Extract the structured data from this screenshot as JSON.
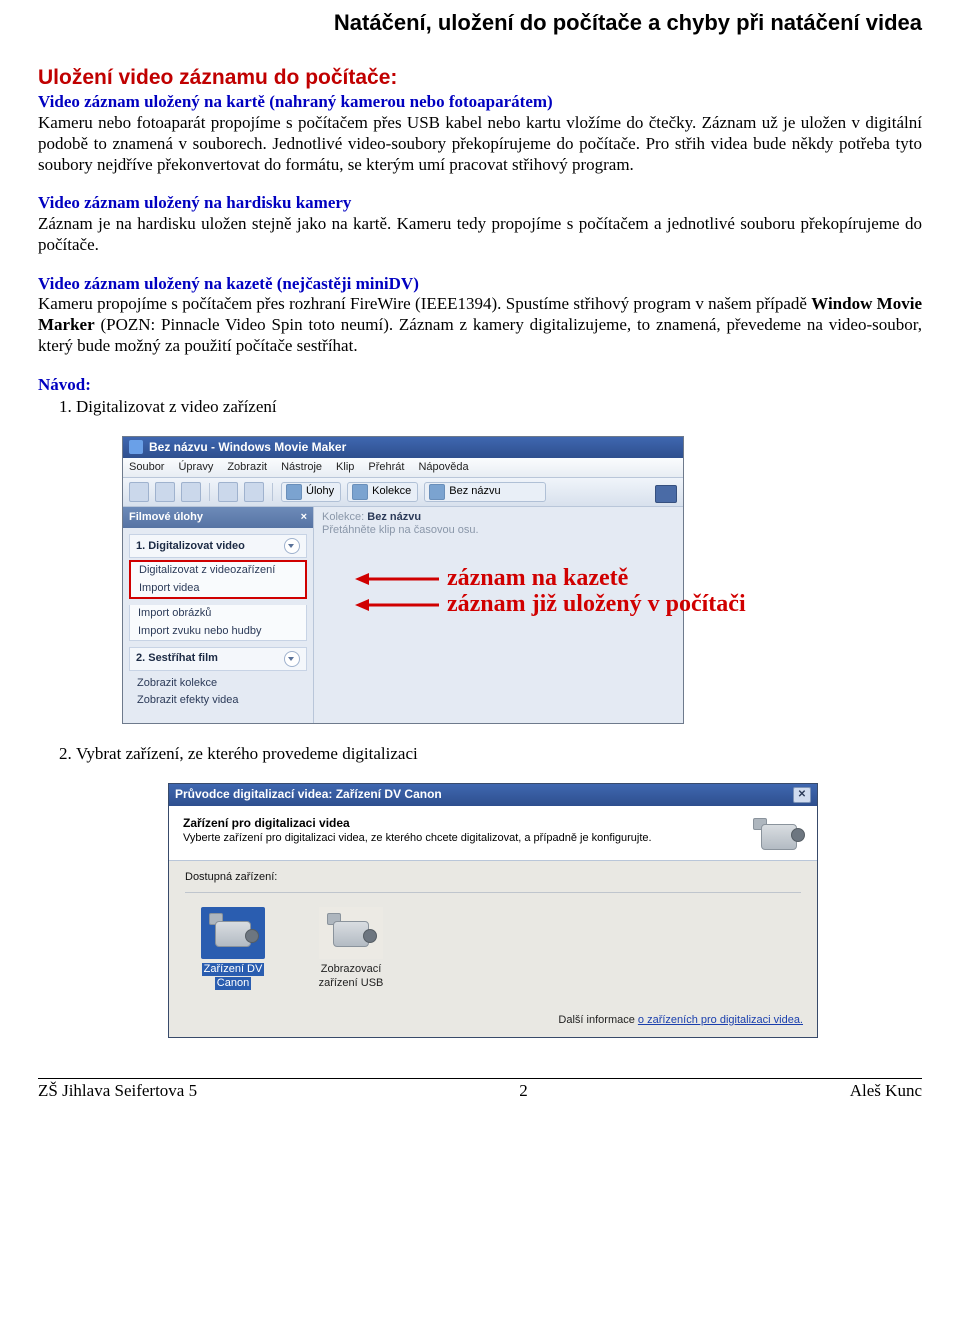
{
  "header": {
    "title": "Natáčení, uložení do počítače a chyby při natáčení videa"
  },
  "section1": {
    "heading": "Uložení video záznamu do počítače:",
    "sub1": "Video záznam uložený na kartě (nahraný kamerou nebo fotoaparátem)",
    "p1": "Kameru nebo fotoaparát propojíme s počítačem přes USB kabel nebo kartu vložíme do čtečky. Záznam už je uložen v digitální podobě to znamená v souborech. Jednotlivé video-soubory překopírujeme do počítače. Pro střih videa bude někdy potřeba tyto soubory nejdříve překonvertovat do formátu, se kterým umí pracovat střihový program.",
    "sub2": "Video záznam uložený na hardisku kamery",
    "p2": "Záznam je na hardisku uložen stejně jako na kartě. Kameru tedy propojíme s počítačem a jednotlivé souboru překopírujeme do počítače.",
    "sub3": "Video záznam uložený na kazetě (nejčastěji miniDV)",
    "p3a": "Kameru propojíme s počítačem přes rozhraní FireWire (IEEE1394). Spustíme střihový program v našem případě ",
    "p3bold": "Window Movie Marker",
    "p3b": " (POZN: Pinnacle Video Spin toto neumí). Záznam z kamery digitalizujeme, to znamená, převedeme na video-soubor, který bude možný za použití počítače sestříhat.",
    "navod": "Návod:",
    "li1": "Digitalizovat z video zařízení",
    "li2": "Vybrat zařízení, ze kterého provedeme digitalizaci"
  },
  "wmm": {
    "title": "Bez názvu - Windows Movie Maker",
    "menu": [
      "Soubor",
      "Úpravy",
      "Zobrazit",
      "Nástroje",
      "Klip",
      "Přehrát",
      "Nápověda"
    ],
    "toolbar": {
      "ulohy": "Úlohy",
      "kolekce": "Kolekce",
      "combo": "Bez názvu"
    },
    "side": {
      "title": "Filmové úlohy",
      "sec1": "1. Digitalizovat video",
      "items1": [
        "Digitalizovat z videozařízení",
        "Import videa",
        "Import obrázků",
        "Import zvuku nebo hudby"
      ],
      "sec2": "2. Sestříhat film",
      "items2": [
        "Zobrazit kolekce",
        "Zobrazit efekty videa"
      ]
    },
    "main": {
      "kolekce_label": "Kolekce:",
      "kolekce_name": "Bez názvu",
      "hint": "Přetáhněte klip na časovou osu."
    },
    "annot1": "záznam na kazetě",
    "annot2": "záznam již uložený v počítači"
  },
  "wiz": {
    "title": "Průvodce digitalizací videa: Zařízení DV Canon",
    "head_bold": "Zařízení pro digitalizaci videa",
    "head_sub": "Vyberte zařízení pro digitalizaci videa, ze kterého chcete digitalizovat, a případně je konfigurujte.",
    "available": "Dostupná zařízení:",
    "dev1": {
      "l1": "Zařízení DV",
      "l2": "Canon"
    },
    "dev2": {
      "l1": "Zobrazovací",
      "l2": "zařízení USB"
    },
    "foot_prefix": "Další informace ",
    "foot_link": "o zařízeních pro digitalizaci videa."
  },
  "footer": {
    "left": "ZŠ Jihlava Seifertova 5",
    "center": "2",
    "right": "Aleš Kunc"
  }
}
